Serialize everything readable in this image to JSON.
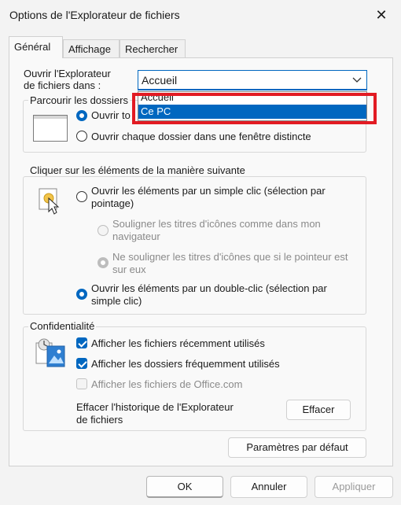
{
  "window": {
    "title": "Options de l'Explorateur de fichiers",
    "close_glyph": "✕"
  },
  "tabs": [
    {
      "label": "Général",
      "active": true
    },
    {
      "label": "Affichage",
      "active": false
    },
    {
      "label": "Rechercher",
      "active": false
    }
  ],
  "open_in": {
    "label_line1": "Ouvrir l'Explorateur",
    "label_line2": "de fichiers dans :",
    "value": "Accueil",
    "options": [
      "Accueil",
      "Ce PC"
    ],
    "highlighted": "Ce PC"
  },
  "browse": {
    "title": "Parcourir les dossiers",
    "option1": "Ouvrir tous les dossiers dans la même fenêtre",
    "option1_visible": "Ouvrir to",
    "option2": "Ouvrir chaque dossier dans une fenêtre distincte",
    "selected": 1
  },
  "click": {
    "title": "Cliquer sur les éléments de la manière suivante",
    "single_line1": "Ouvrir les éléments par un simple clic (sélection par",
    "single_line2": "pointage)",
    "underline_like_browser_line1": "Souligner les titres d'icônes comme dans mon",
    "underline_like_browser_line2": "navigateur",
    "underline_on_point_line1": "Ne souligner les titres d'icônes que si le pointeur est",
    "underline_on_point_line2": "sur eux",
    "double_line1": "Ouvrir les éléments par un double-clic (sélection par",
    "double_line2": "simple clic)",
    "selected": "double"
  },
  "privacy": {
    "title": "Confidentialité",
    "recent_files": "Afficher les fichiers récemment utilisés",
    "frequent_folders": "Afficher les dossiers fréquemment utilisés",
    "office_files": "Afficher les fichiers de Office.com",
    "clear_history_line1": "Effacer l'historique de l'Explorateur",
    "clear_history_line2": "de fichiers",
    "clear_button": "Effacer"
  },
  "buttons": {
    "defaults": "Paramètres par défaut",
    "ok": "OK",
    "cancel": "Annuler",
    "apply": "Appliquer"
  },
  "colors": {
    "accent": "#0067c0",
    "annotation": "#e21b23"
  },
  "icons": {
    "folder_window": "folder-window-icon",
    "pointer": "click-pointer-icon",
    "privacy": "privacy-files-icon",
    "chevron": "chevron-down-icon"
  }
}
